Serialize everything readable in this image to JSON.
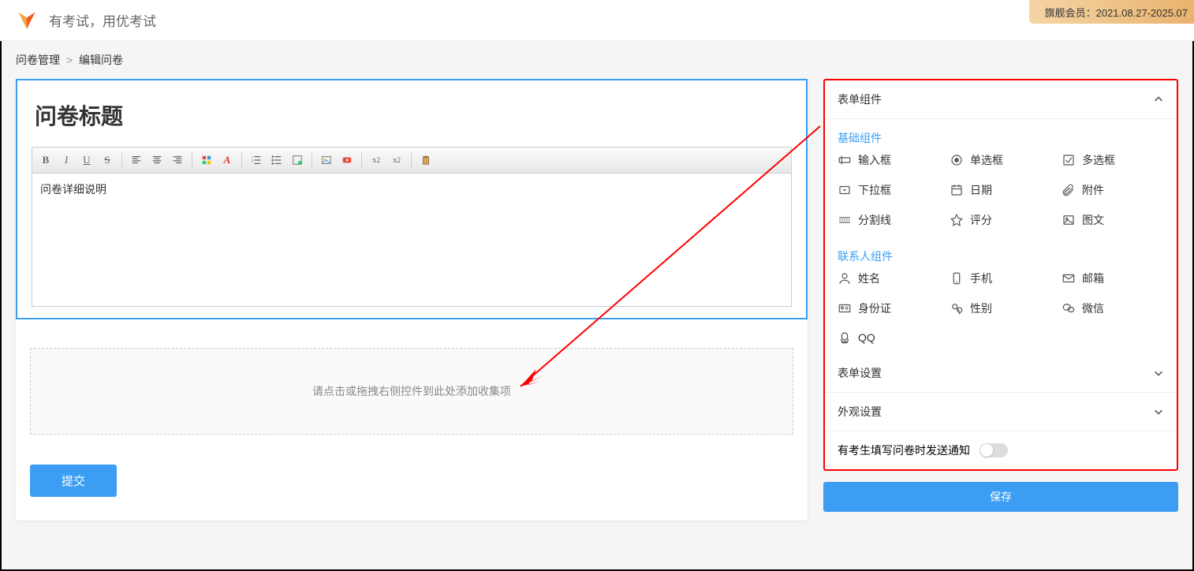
{
  "header": {
    "slogan": "有考试，用优考试",
    "vip_badge": "旗舰会员：2021.08.27-2025.07"
  },
  "breadcrumb": {
    "level1": "问卷管理",
    "sep": ">",
    "level2": "编辑问卷"
  },
  "editor": {
    "title": "问卷标题",
    "desc_placeholder": "问卷详细说明",
    "dropzone_text": "请点击或拖拽右侧控件到此处添加收集项",
    "submit_label": "提交"
  },
  "panel": {
    "section_components": "表单组件",
    "sub_basic": "基础组件",
    "basic_items": {
      "input": "输入框",
      "radio": "单选框",
      "checkbox": "多选框",
      "dropdown": "下拉框",
      "date": "日期",
      "attachment": "附件",
      "divider": "分割线",
      "rating": "评分",
      "image_text": "图文"
    },
    "sub_contact": "联系人组件",
    "contact_items": {
      "name": "姓名",
      "phone": "手机",
      "email": "邮箱",
      "idcard": "身份证",
      "gender": "性别",
      "wechat": "微信",
      "qq": "QQ"
    },
    "section_form_settings": "表单设置",
    "section_appearance": "外观设置",
    "notify_label": "有考生填写问卷时发送通知",
    "save_label": "保存"
  }
}
